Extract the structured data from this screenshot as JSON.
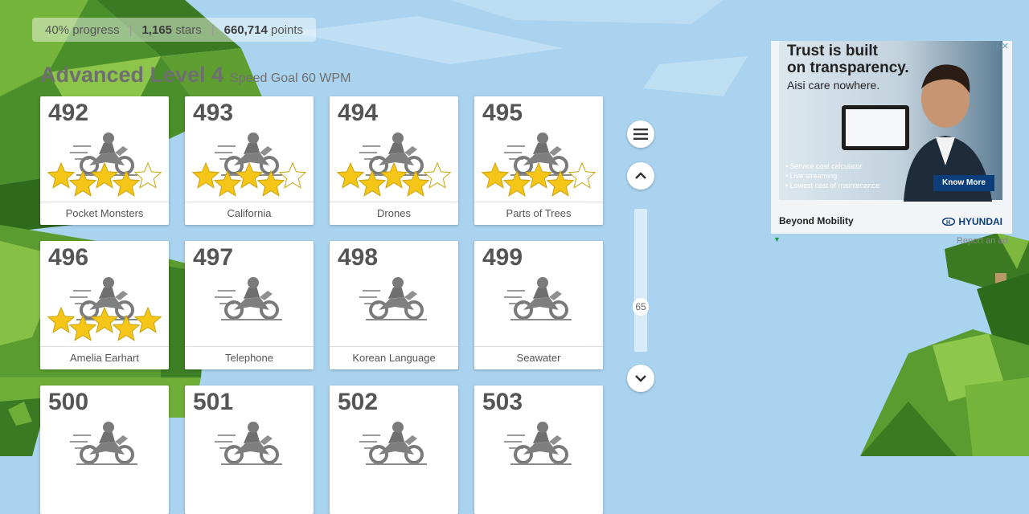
{
  "stats": {
    "progress_value": "40%",
    "progress_label": "progress",
    "stars_value": "1,165",
    "stars_label": "stars",
    "points_value": "660,714",
    "points_label": "points"
  },
  "level": {
    "title": "Advanced Level 4",
    "speed_goal": "Speed Goal 60 WPM"
  },
  "cards": [
    {
      "number": "492",
      "title": "Pocket Monsters",
      "stars_filled": 4
    },
    {
      "number": "493",
      "title": "California",
      "stars_filled": 4
    },
    {
      "number": "494",
      "title": "Drones",
      "stars_filled": 4
    },
    {
      "number": "495",
      "title": "Parts of Trees",
      "stars_filled": 4
    },
    {
      "number": "496",
      "title": "Amelia Earhart",
      "stars_filled": 5
    },
    {
      "number": "497",
      "title": "Telephone",
      "stars_filled": 0
    },
    {
      "number": "498",
      "title": "Korean Language",
      "stars_filled": 0
    },
    {
      "number": "499",
      "title": "Seawater",
      "stars_filled": 0
    },
    {
      "number": "500",
      "title": "",
      "stars_filled": 0
    },
    {
      "number": "501",
      "title": "",
      "stars_filled": 0
    },
    {
      "number": "502",
      "title": "",
      "stars_filled": 0
    },
    {
      "number": "503",
      "title": "",
      "stars_filled": 0
    }
  ],
  "controls": {
    "menu_icon": "menu-icon",
    "up_icon": "chevron-up-icon",
    "down_icon": "chevron-down-icon",
    "slider_value": "65",
    "slider_level": 0.65
  },
  "ad": {
    "headline_1": "Trust is built",
    "headline_2": "on transparency.",
    "subline": "Aisi care nowhere.",
    "bullets": [
      "Service cost calculator",
      "Live streaming",
      "Lowest cost of maintenance"
    ],
    "cta": "Know More",
    "tagline": "Beyond Mobility",
    "brand": "HYUNDAI",
    "report_link": "Report an ad"
  },
  "colors": {
    "sky": "#a9d3ef",
    "star_fill": "#f5c518",
    "star_empty": "#ffffff",
    "bike": "#8a8a8a",
    "ad_button": "#0b3e7a"
  }
}
